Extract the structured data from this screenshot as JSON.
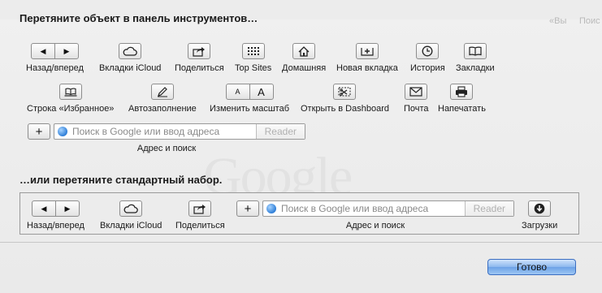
{
  "background": {
    "ghost_text_1": "«Вы",
    "ghost_text_2": "Поис",
    "ghost_logo": "Google"
  },
  "headings": {
    "drag_items": "Перетяните объект в панель инструментов…",
    "drag_default": "…или перетяните стандартный набор."
  },
  "toolbar_items": {
    "back_forward": "Назад/вперед",
    "icloud_tabs": "Вкладки iCloud",
    "share": "Поделиться",
    "top_sites": "Top Sites",
    "home": "Домашняя",
    "new_tab": "Новая вкладка",
    "history": "История",
    "bookmarks": "Закладки",
    "favorites_bar": "Строка «Избранное»",
    "autofill": "Автозаполнение",
    "zoom": "Изменить масштаб",
    "dashboard": "Открыть в Dashboard",
    "mail": "Почта",
    "print": "Напечатать",
    "address_search": "Адрес и поиск",
    "downloads": "Загрузки"
  },
  "address_bar": {
    "placeholder": "Поиск в Google или ввод адреса",
    "reader": "Reader",
    "plus": "+"
  },
  "zoom_glyphs": {
    "small": "A",
    "large": "A"
  },
  "buttons": {
    "done": "Готово"
  },
  "colors": {
    "done_button": "#8cb8ee",
    "globe": "#2f7fd8"
  }
}
